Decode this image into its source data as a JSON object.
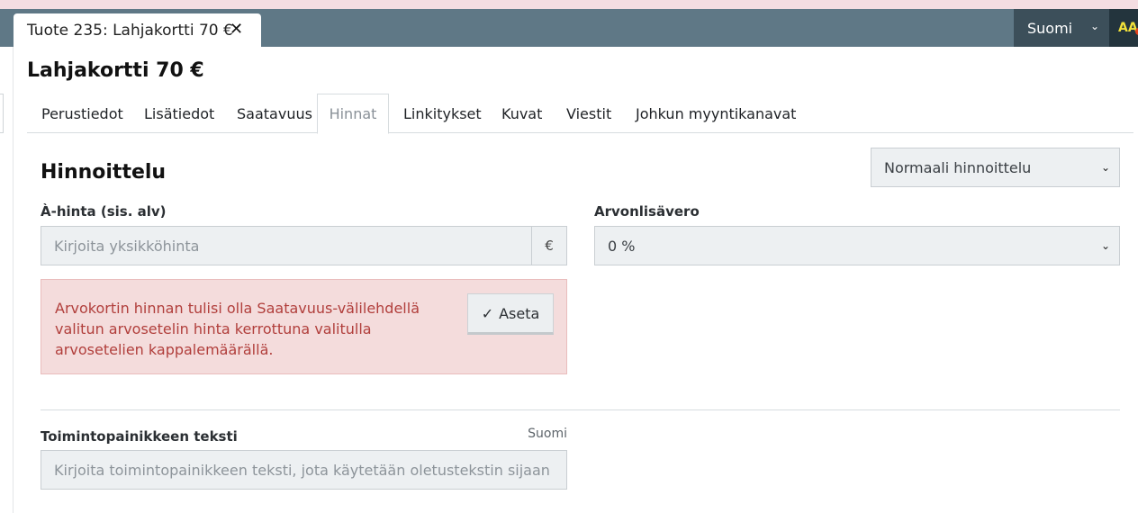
{
  "window": {
    "tab_title": "Tuote 235: Lahjakortti 70 €",
    "close_glyph": "✕",
    "language": "Suomi",
    "chevron_glyph": "⌄",
    "avatar_initials": "AA"
  },
  "page": {
    "title": "Lahjakortti 70 €",
    "tabs": [
      {
        "label": "Perustiedot"
      },
      {
        "label": "Lisätiedot"
      },
      {
        "label": "Saatavuus"
      },
      {
        "label": "Hinnat"
      },
      {
        "label": "Linkitykset"
      },
      {
        "label": "Kuvat"
      },
      {
        "label": "Viestit"
      },
      {
        "label": "Johkun myyntikanavat"
      }
    ],
    "active_tab": "Hinnat"
  },
  "pricing": {
    "section_title": "Hinnoittelu",
    "mode_select": "Normaali hinnoittelu",
    "unit_price_label": "À-hinta (sis. alv)",
    "unit_price_placeholder": "Kirjoita yksikköhinta",
    "unit_price_value": "",
    "currency": "€",
    "vat_label": "Arvonlisävero",
    "vat_value": "0 %",
    "warning_text": "Arvokortin hinnan tulisi olla Saatavuus-välilehdellä valitun arvosetelin hinta kerrottuna valitulla arvosetelien kappalemäärällä.",
    "set_button_label": "Aseta",
    "check_glyph": "✓"
  },
  "action_button": {
    "label": "Toimintopainikkeen teksti",
    "language_hint": "Suomi",
    "placeholder": "Kirjoita toimintopainikkeen teksti, jota käytetään oletustekstin sijaan",
    "value": ""
  },
  "colors": {
    "topbar": "#5f7886",
    "language_button": "#3c4f5a",
    "warning_background": "#f4dcdc",
    "warning_text": "#b13f3c",
    "input_background": "#edf0f2"
  }
}
